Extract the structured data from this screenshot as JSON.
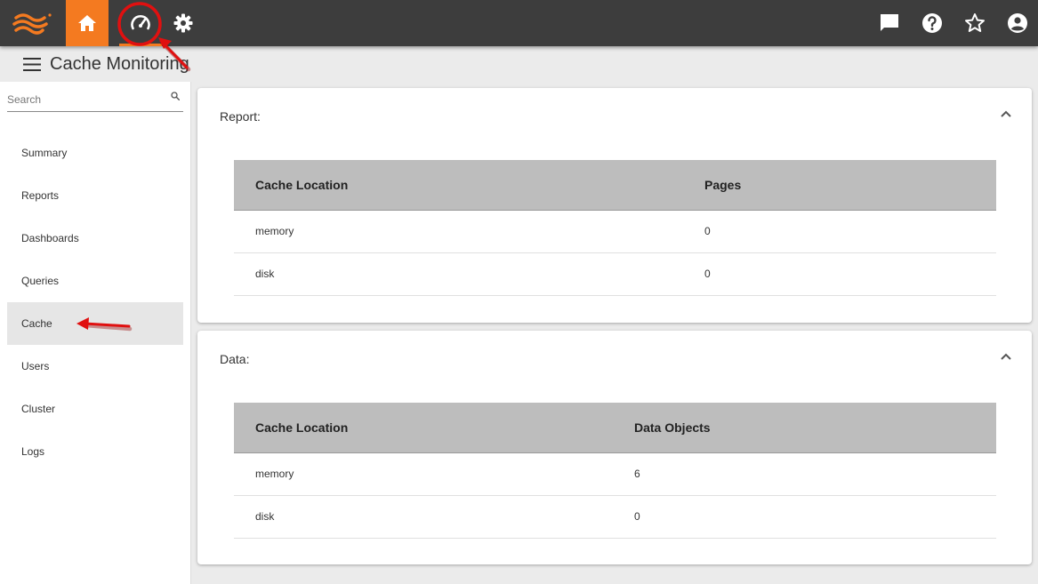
{
  "colors": {
    "accent": "#f47a20",
    "topbar": "#3d3d3d",
    "annotation": "#e01010"
  },
  "topbar": {
    "logo_icon": "waves-logo-icon",
    "nav": [
      {
        "icon": "home-icon",
        "active": true
      },
      {
        "icon": "speedometer-icon",
        "active": false
      },
      {
        "icon": "gear-icon",
        "active": false
      }
    ],
    "right_icons": [
      "chat-icon",
      "help-icon",
      "star-icon",
      "account-icon"
    ]
  },
  "header": {
    "title": "Cache Monitoring",
    "menu_icon": "menu-icon"
  },
  "sidebar": {
    "search": {
      "placeholder": "Search",
      "value": ""
    },
    "items": [
      {
        "label": "Summary"
      },
      {
        "label": "Reports"
      },
      {
        "label": "Dashboards"
      },
      {
        "label": "Queries"
      },
      {
        "label": "Cache",
        "active": true
      },
      {
        "label": "Users"
      },
      {
        "label": "Cluster"
      },
      {
        "label": "Logs"
      }
    ]
  },
  "report_panel": {
    "title": "Report:",
    "columns": [
      "Cache Location",
      "Pages"
    ],
    "rows": [
      [
        "memory",
        "0"
      ],
      [
        "disk",
        "0"
      ]
    ]
  },
  "data_panel": {
    "title": "Data:",
    "columns": [
      "Cache Location",
      "Data Objects"
    ],
    "rows": [
      [
        "memory",
        "6"
      ],
      [
        "disk",
        "0"
      ]
    ]
  }
}
